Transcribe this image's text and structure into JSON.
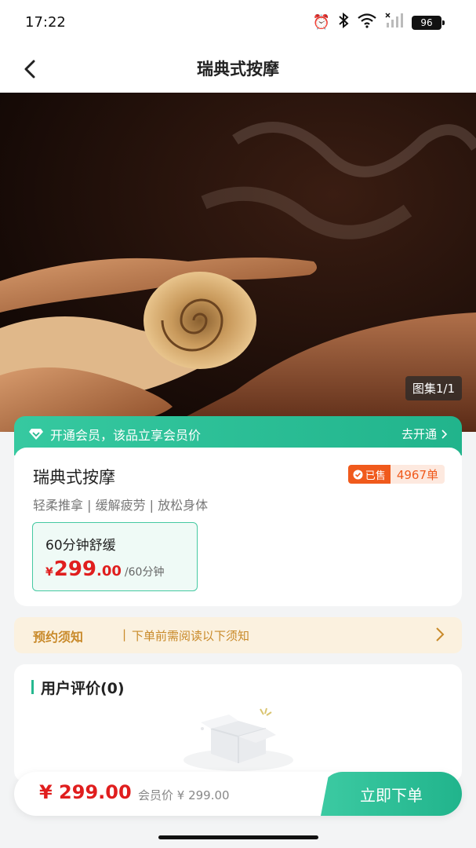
{
  "status_bar": {
    "time": "17:22",
    "battery": "96"
  },
  "nav": {
    "title": "瑞典式按摩"
  },
  "hero": {
    "gallery_label": "图集1/1"
  },
  "member_banner": {
    "text": "开通会员，该品立享会员价",
    "action": "去开通"
  },
  "product": {
    "name": "瑞典式按摩",
    "sold_tag": "已售",
    "sold_count": "4967单",
    "description": "轻柔推拿 | 缓解疲劳 | 放松身体",
    "option": {
      "name": "60分钟舒缓",
      "currency": "¥",
      "price_int": "299",
      "price_dec": ".00",
      "unit": "/60分钟"
    }
  },
  "notice": {
    "label": "预约须知",
    "separator": "|",
    "text": "下单前需阅读以下须知"
  },
  "reviews": {
    "title": "用户评价(0)"
  },
  "bottom_bar": {
    "price": "¥ 299.00",
    "member_price": "会员价 ¥ 299.00",
    "buy_label": "立即下单"
  },
  "colors": {
    "accent": "#21b48c",
    "price": "#e01e1e",
    "notice": "#c98a2a",
    "sold": "#f05a1c"
  }
}
